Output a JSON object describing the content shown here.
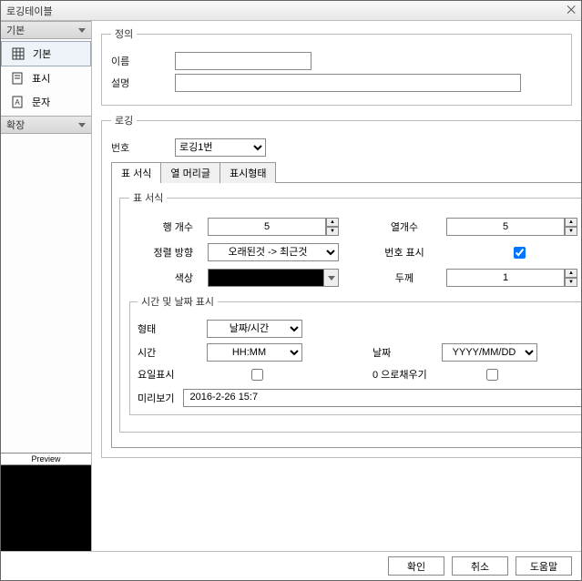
{
  "title": "로깅테이블",
  "sidebar": {
    "basic_head": "기본",
    "ext_head": "확장",
    "items": [
      "기본",
      "표시",
      "문자"
    ],
    "preview_label": "Preview"
  },
  "def": {
    "legend": "정의",
    "name_label": "이름",
    "name_value": "",
    "desc_label": "설명",
    "desc_value": ""
  },
  "logging": {
    "legend": "로깅",
    "num_label": "번호",
    "num_value": "로깅1번"
  },
  "tabs": [
    "표 서식",
    "열 머리글",
    "표시형태"
  ],
  "table_format": {
    "legend": "표 서식",
    "row_count_label": "행 개수",
    "row_count": "5",
    "col_count_label": "열개수",
    "col_count": "5",
    "sort_label": "정렬 방향",
    "sort_value": "오래된것 -> 최근것",
    "numshow_label": "번호 표시",
    "numshow_checked": true,
    "color_label": "색상",
    "thick_label": "두께",
    "thick_value": "1"
  },
  "datetime": {
    "legend": "시간 및 날짜 표시",
    "form_label": "형태",
    "form_value": "날짜/시간",
    "time_label": "시간",
    "time_value": "HH:MM",
    "date_label": "날짜",
    "date_value": "YYYY/MM/DD",
    "dow_label": "요일표시",
    "dow_checked": false,
    "zero_label": "0 으로채우기",
    "zero_checked": false,
    "preview_label": "미리보기",
    "preview_value": "2016-2-26 15:7"
  },
  "footer": {
    "ok": "확인",
    "cancel": "취소",
    "help": "도움말"
  }
}
